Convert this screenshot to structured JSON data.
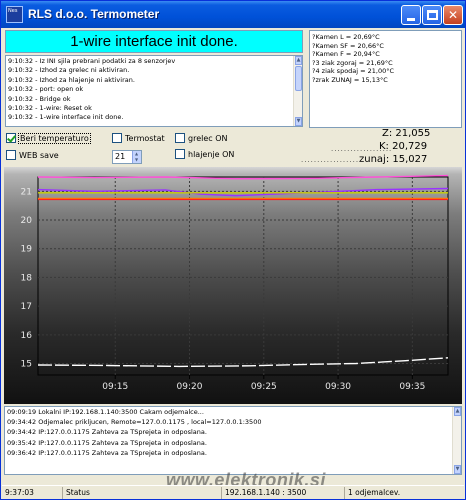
{
  "window": {
    "title": "RLS d.o.o. Termometer",
    "icon_label": "Nes",
    "controls": [
      "minimize-icon",
      "maximize-icon",
      "close-icon"
    ]
  },
  "banner": {
    "text": "1-wire interface init done.",
    "color": "#00ffff"
  },
  "event_list": {
    "lines": [
      "9:10:32 - Iz INI sjila prebrani podatki za 8 senzorjev",
      "9:10:32 - Izhod za grelec ni aktiviran.",
      "9:10:32 - Izhod za hlajenje ni aktiviran.",
      "9:10:32 - port: open ok",
      "9:10:32 - Bridge ok",
      "9:10:32 - 1-wire: Reset ok",
      "9:10:32 - 1-wire interface init done."
    ]
  },
  "sensor_list": {
    "lines": [
      "?Kamen L = 20,69°C",
      "?Kamen SF = 20,66°C",
      "?Kamen F = 20,94°C",
      "?3 ziak zgoraj = 21,69°C",
      "?4 ziak spodaj = 21,00°C",
      "?zrak ZUNAJ = 15,13°C"
    ]
  },
  "controls": {
    "beri_temperaturo": {
      "label": "Beri temperaturo",
      "checked": true
    },
    "web_save": {
      "label": "WEB save",
      "checked": false
    },
    "termostat": {
      "label": "Termostat",
      "checked": false
    },
    "grelec_on": {
      "label": "grelec ON",
      "checked": false
    },
    "hlajenje_on": {
      "label": "hlajenje ON",
      "checked": false
    },
    "spin_value": "21"
  },
  "readouts": {
    "z": "Z: 21,055",
    "k": "K: 20,729",
    "zunaj": "zunaj: 15,027",
    "dots1": "...................",
    "dots2": "...................."
  },
  "chart_data": {
    "type": "line",
    "x_ticks": [
      "09:15",
      "09:20",
      "09:25",
      "09:30",
      "09:35"
    ],
    "y_ticks": [
      "21",
      "20",
      "19",
      "18",
      "17",
      "16",
      "15"
    ],
    "ylim": [
      14.6,
      21.5
    ],
    "grid": true,
    "series": [
      {
        "color": "#ff4fd8",
        "x": [
          9.1,
          9.18,
          9.28,
          9.38,
          9.48,
          9.58,
          9.68
        ],
        "values": [
          21.5,
          21.48,
          21.5,
          21.44,
          21.45,
          21.5,
          21.55
        ]
      },
      {
        "color": "#9933ff",
        "x": [
          9.1,
          9.18,
          9.28,
          9.33,
          9.38,
          9.48,
          9.58,
          9.68
        ],
        "values": [
          21.06,
          21.0,
          21.05,
          20.9,
          20.85,
          20.95,
          21.06,
          21.1
        ]
      },
      {
        "color": "#c8d000",
        "x": [
          9.1,
          9.68
        ],
        "values": [
          20.95,
          20.95
        ]
      },
      {
        "color": "#ff8800",
        "x": [
          9.1,
          9.68
        ],
        "values": [
          20.75,
          20.75
        ]
      },
      {
        "color": "#ff2020",
        "x": [
          9.1,
          9.68
        ],
        "values": [
          20.72,
          20.72
        ]
      },
      {
        "color": "#ffffff",
        "x": [
          9.1,
          9.2,
          9.3,
          9.4,
          9.48,
          9.55,
          9.62,
          9.68
        ],
        "values": [
          14.95,
          14.93,
          14.9,
          14.92,
          14.97,
          15.0,
          15.1,
          15.2
        ]
      }
    ],
    "colors": {
      "grid": "#3a3a3a",
      "axis": "#000000",
      "text": "#e8e8e8"
    }
  },
  "log": {
    "lines": [
      "09:09:19 Lokalni IP:192.168.1.140:3500 Cakam odjemalce...",
      "09:34:42 Odjemalec prikljucen, Remote=127.0.0.1175 , local=127.0.0.1:3500",
      "09:34:42 IP:127.0.0.1175 Zahteva za TSprejeta in odposlana.",
      "09:35:42 IP:127.0.0.1175 Zahteva za TSprejeta in odposlana.",
      "09:36:42 IP:127.0.0.1175 Zahteva za TSprejeta in odposlana."
    ]
  },
  "statusbar": {
    "time": "9:37:03",
    "status": "Status",
    "address": "192.168.1.140 : 3500",
    "clients": "1 odjemalcev."
  },
  "watermark": "www.elektronik.si"
}
